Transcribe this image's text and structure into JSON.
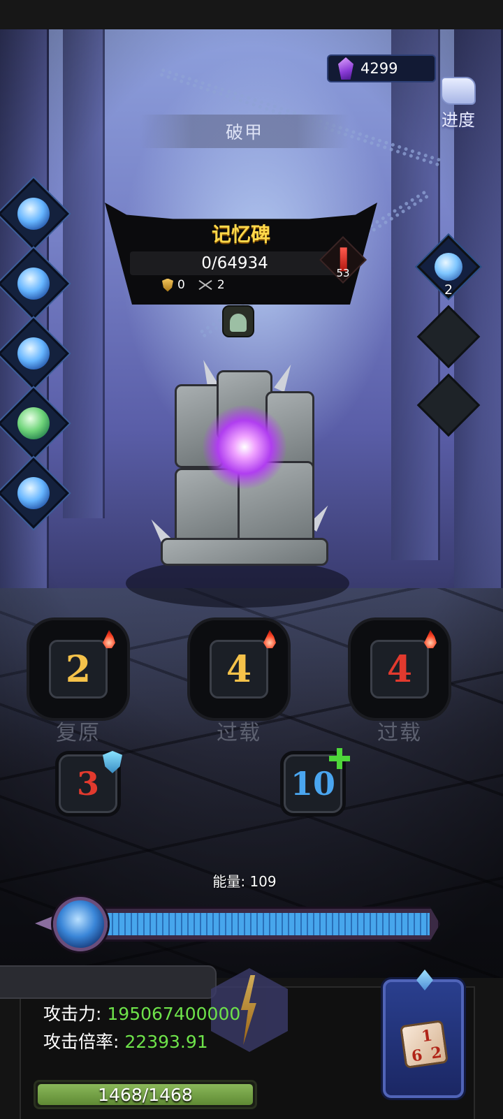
{
  "currency": {
    "gems": "4299",
    "icon": "purple-gem-icon"
  },
  "progress_button": {
    "label": "进度"
  },
  "debuff_banner": {
    "label": "破甲"
  },
  "boss": {
    "name": "记忆碑",
    "hp_text": "0/64934",
    "armor": "0",
    "pierce": "2",
    "attack_badge": "53",
    "hp_fraction": 0
  },
  "right_slots": {
    "orb_count": "2"
  },
  "dice_slots": [
    {
      "value": "2",
      "value_color": "#f5c24a",
      "label": "复原"
    },
    {
      "value": "4",
      "value_color": "#f5c24a",
      "label": "过载"
    },
    {
      "value": "4",
      "value_color": "#e23a2e",
      "label": "过载"
    }
  ],
  "small_dice": [
    {
      "value": "3",
      "value_color": "#e23a2e",
      "badge": "shield-icon"
    },
    {
      "value": "10",
      "value_color": "#4aa6f0",
      "badge": "plus-icon"
    }
  ],
  "energy": {
    "label": "能量: 109",
    "fraction": 1.0
  },
  "stats": {
    "attack_label": "攻击力:",
    "attack_value": "195067400000",
    "multiplier_label": "攻击倍率:",
    "multiplier_value": "22393.91"
  },
  "player_hp": {
    "text": "1468/1468",
    "fraction": 1.0
  },
  "colors": {
    "accent_gold": "#ffd84a",
    "hp_green": "#6ee34a",
    "energy_blue": "#47a6ec"
  }
}
